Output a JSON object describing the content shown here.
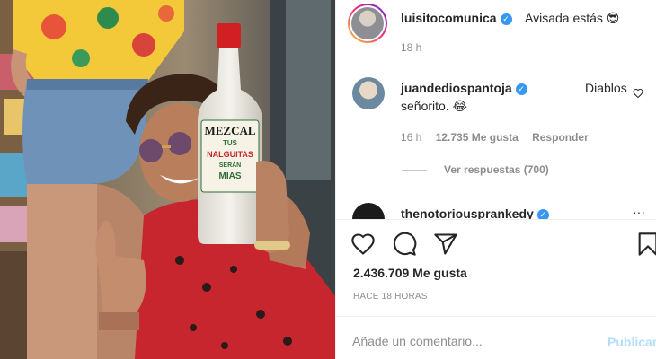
{
  "caption": {
    "username": "luisitocomunica",
    "text": "Avisada estás 😎",
    "time": "18 h"
  },
  "comments": [
    {
      "username": "juandediospantoja",
      "text_line1": "Diablos",
      "text_line2": "señorito. 😂",
      "time": "16 h",
      "likes": "12.735 Me gusta",
      "reply_label": "Responder",
      "view_replies": "Ver respuestas (700)"
    },
    {
      "username": "thenotoriousprankedy"
    }
  ],
  "post": {
    "likes": "2.436.709 Me gusta",
    "time_ago": "HACE 18 HORAS"
  },
  "composer": {
    "placeholder": "Añade un comentario...",
    "submit_label": "Publicar"
  },
  "photo": {
    "bottle_brand": "MEZCAL",
    "bottle_line1": "TUS",
    "bottle_line2": "NALGUITAS",
    "bottle_line3": "SERÁN",
    "bottle_line4": "MIAS"
  },
  "colors": {
    "verified": "#3897f0",
    "publish": "#b2dffc",
    "muted": "#8e8e8e"
  }
}
